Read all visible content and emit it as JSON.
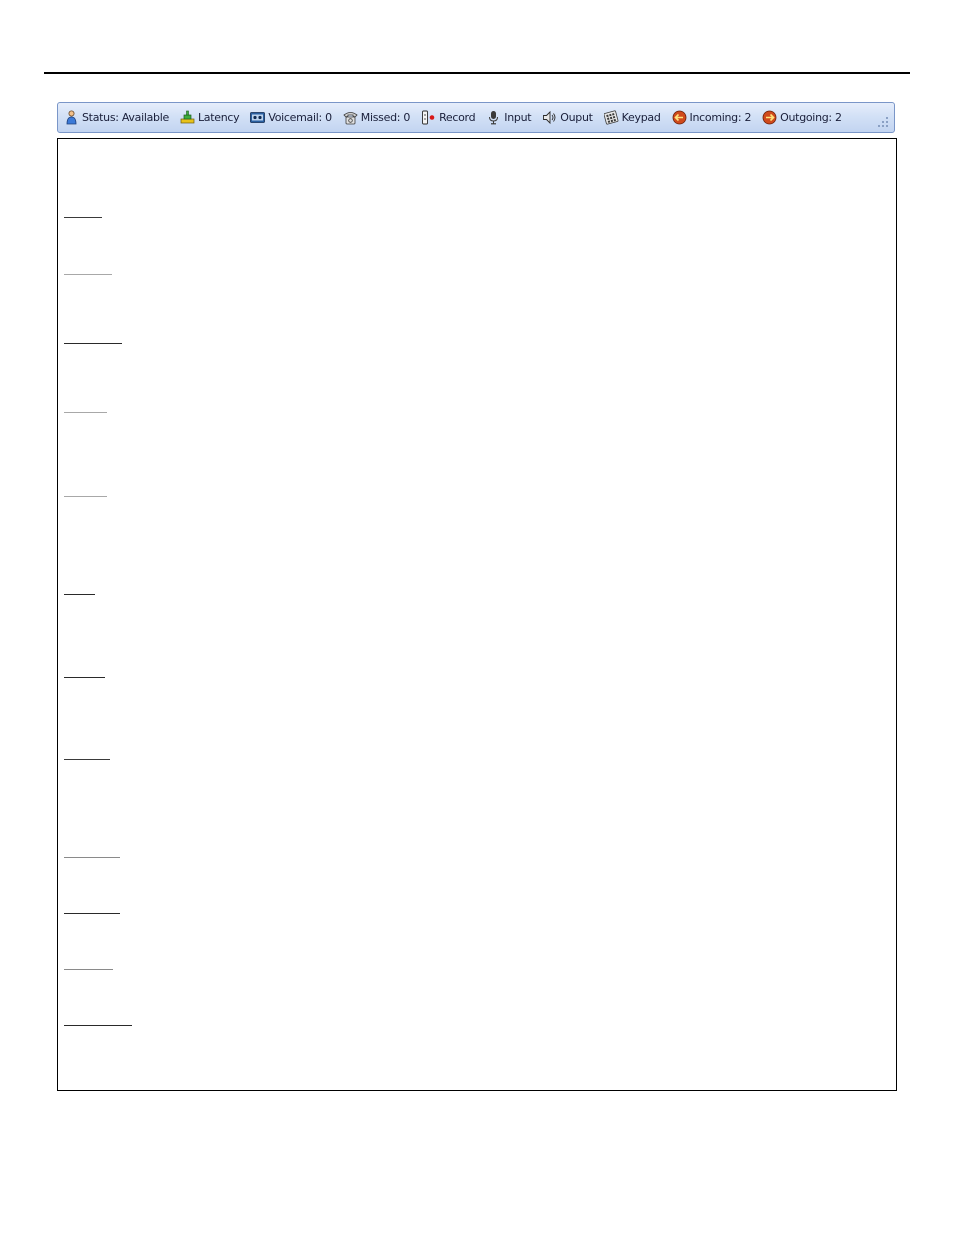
{
  "statusbar": {
    "items": [
      {
        "label": "Status: Available",
        "icon": "status-person-icon"
      },
      {
        "label": "Latency",
        "icon": "latency-icon"
      },
      {
        "label": "Voicemail: 0",
        "icon": "voicemail-icon"
      },
      {
        "label": "Missed: 0",
        "icon": "phone-icon"
      },
      {
        "label": "Record",
        "icon": "record-icon"
      },
      {
        "label": "Input",
        "icon": "microphone-icon"
      },
      {
        "label": "Ouput",
        "icon": "speaker-icon"
      },
      {
        "label": "Keypad",
        "icon": "keypad-icon"
      },
      {
        "label": "Incoming: 2",
        "icon": "incoming-call-icon"
      },
      {
        "label": "Outgoing: 2",
        "icon": "outgoing-call-icon"
      }
    ]
  },
  "colors": {
    "statusbar_border": "#7a96c8",
    "statusbar_bg": "#d3e1f6",
    "record_dot": "#d81818",
    "incoming": "#d04a1c",
    "outgoing": "#d04a1c"
  }
}
